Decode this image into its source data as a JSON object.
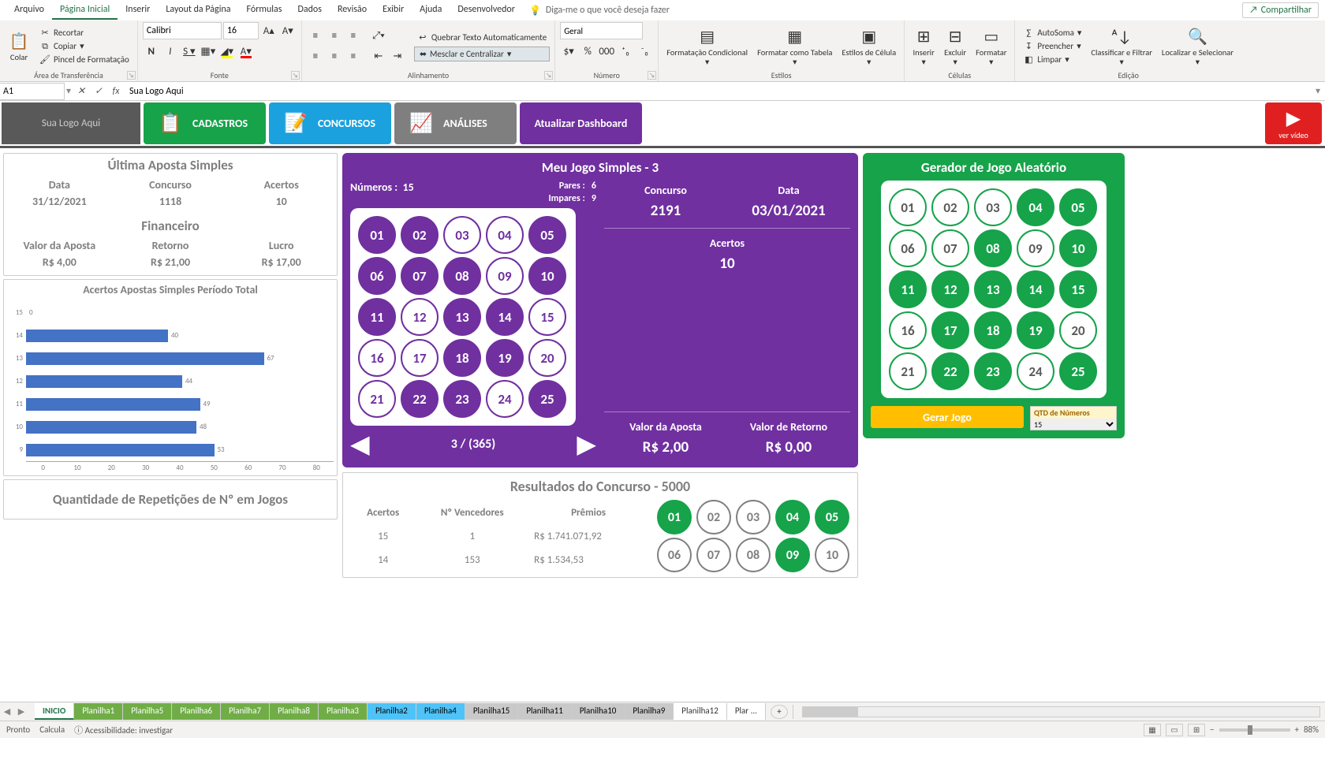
{
  "menu": {
    "items": [
      "Arquivo",
      "Página Inicial",
      "Inserir",
      "Layout da Página",
      "Fórmulas",
      "Dados",
      "Revisão",
      "Exibir",
      "Ajuda",
      "Desenvolvedor"
    ],
    "active_index": 1,
    "tell_me": "Diga-me o que você deseja fazer",
    "share": "Compartilhar"
  },
  "ribbon": {
    "clipboard": {
      "paste": "Colar",
      "cut": "Recortar",
      "copy": "Copiar",
      "painter": "Pincel de Formatação",
      "label": "Área de Transferência"
    },
    "font": {
      "name": "Calibri",
      "size": "16",
      "label": "Fonte"
    },
    "alignment": {
      "wrap": "Quebrar Texto Automaticamente",
      "merge": "Mesclar e Centralizar",
      "label": "Alinhamento"
    },
    "number": {
      "format": "Geral",
      "label": "Número"
    },
    "styles": {
      "cond": "Formatação Condicional",
      "table": "Formatar como Tabela",
      "cell": "Estilos de Célula",
      "label": "Estilos"
    },
    "cells": {
      "insert": "Inserir",
      "delete": "Excluir",
      "format": "Formatar",
      "label": "Células"
    },
    "editing": {
      "sum": "AutoSoma",
      "fill": "Preencher",
      "clear": "Limpar",
      "sort": "Classificar e Filtrar",
      "find": "Localizar e Selecionar",
      "label": "Edição"
    }
  },
  "formula_bar": {
    "name_box": "A1",
    "formula": "Sua Logo Aqui"
  },
  "dash_buttons": {
    "logo": "Sua Logo Aqui",
    "cadastros": "CADASTROS",
    "concursos": "CONCURSOS",
    "analises": "ANÁLISES",
    "atualizar": "Atualizar Dashboard",
    "video": "ver vídeo"
  },
  "last_bet": {
    "title": "Última Aposta Simples",
    "data_lbl": "Data",
    "data_val": "31/12/2021",
    "conc_lbl": "Concurso",
    "conc_val": "1118",
    "acertos_lbl": "Acertos",
    "acertos_val": "10",
    "fin_title": "Financeiro",
    "aposta_lbl": "Valor da Aposta",
    "aposta_val": "R$ 4,00",
    "ret_lbl": "Retorno",
    "ret_val": "R$ 21,00",
    "lucro_lbl": "Lucro",
    "lucro_val": "R$ 17,00"
  },
  "chart_data": {
    "type": "bar",
    "title": "Acertos Apostas Simples Período Total",
    "categories": [
      "15",
      "14",
      "13",
      "12",
      "11",
      "10",
      "9"
    ],
    "values": [
      0,
      40,
      67,
      44,
      49,
      48,
      53
    ],
    "x_ticks": [
      "0",
      "10",
      "20",
      "30",
      "40",
      "50",
      "60",
      "70",
      "80"
    ],
    "xlim": [
      0,
      80
    ]
  },
  "rep_title": "Quantidade de Repetições de Nº em Jogos",
  "jogo": {
    "title": "Meu Jogo Simples - 3",
    "numeros_lbl": "Números :",
    "numeros_val": "15",
    "pares_lbl": "Pares :",
    "pares_val": "6",
    "impares_lbl": "Impares :",
    "impares_val": "9",
    "concurso_lbl": "Concurso",
    "concurso_val": "2191",
    "data_lbl": "Data",
    "data_val": "03/01/2021",
    "acertos_lbl": "Acertos",
    "acertos_val": "10",
    "aposta_lbl": "Valor da Aposta",
    "aposta_val": "R$ 2,00",
    "ret_lbl": "Valor de Retorno",
    "ret_val": "R$ 0,00",
    "balls": [
      "01",
      "02",
      "03",
      "04",
      "05",
      "06",
      "07",
      "08",
      "09",
      "10",
      "11",
      "12",
      "13",
      "14",
      "15",
      "16",
      "17",
      "18",
      "19",
      "20",
      "21",
      "22",
      "23",
      "24",
      "25"
    ],
    "selected": [
      0,
      1,
      4,
      5,
      6,
      7,
      9,
      10,
      12,
      13,
      17,
      18,
      21,
      22,
      24
    ],
    "pager": "3 / (365)"
  },
  "results": {
    "title": "Resultados do Concurso - 5000",
    "headers": [
      "Acertos",
      "Nº Vencedores",
      "Prêmios"
    ],
    "rows": [
      [
        "15",
        "1",
        "R$ 1.741.071,92"
      ],
      [
        "14",
        "153",
        "R$ 1.534,53"
      ]
    ],
    "balls": [
      "01",
      "02",
      "03",
      "04",
      "05",
      "06",
      "07",
      "08",
      "09",
      "10"
    ],
    "selected": [
      0,
      3,
      4,
      8
    ]
  },
  "generator": {
    "title": "Gerador de Jogo Aleatório",
    "balls": [
      "01",
      "02",
      "03",
      "04",
      "05",
      "06",
      "07",
      "08",
      "09",
      "10",
      "11",
      "12",
      "13",
      "14",
      "15",
      "16",
      "17",
      "18",
      "19",
      "20",
      "21",
      "22",
      "23",
      "24",
      "25"
    ],
    "selected": [
      3,
      4,
      7,
      9,
      10,
      11,
      12,
      13,
      14,
      16,
      17,
      18,
      21,
      22,
      24
    ],
    "btn": "Gerar Jogo",
    "qty_caption": "QTD de Números",
    "qty_val": "15"
  },
  "tabs": {
    "list": [
      {
        "name": "INICIO",
        "cls": "active"
      },
      {
        "name": "Planilha1",
        "cls": "green"
      },
      {
        "name": "Planilha5",
        "cls": "green"
      },
      {
        "name": "Planilha6",
        "cls": "green"
      },
      {
        "name": "Planilha7",
        "cls": "green"
      },
      {
        "name": "Planilha8",
        "cls": "green"
      },
      {
        "name": "Planilha3",
        "cls": "green"
      },
      {
        "name": "Planilha2",
        "cls": "blue"
      },
      {
        "name": "Planilha4",
        "cls": "blue"
      },
      {
        "name": "Planilha15",
        "cls": "grey"
      },
      {
        "name": "Planilha11",
        "cls": "grey"
      },
      {
        "name": "Planilha10",
        "cls": "grey"
      },
      {
        "name": "Planilha9",
        "cls": "grey"
      },
      {
        "name": "Planilha12",
        "cls": "plain"
      },
      {
        "name": "Plar ...",
        "cls": "plain"
      }
    ]
  },
  "status": {
    "ready": "Pronto",
    "calc": "Calcula",
    "access": "Acessibilidade: investigar",
    "zoom": "88%"
  }
}
